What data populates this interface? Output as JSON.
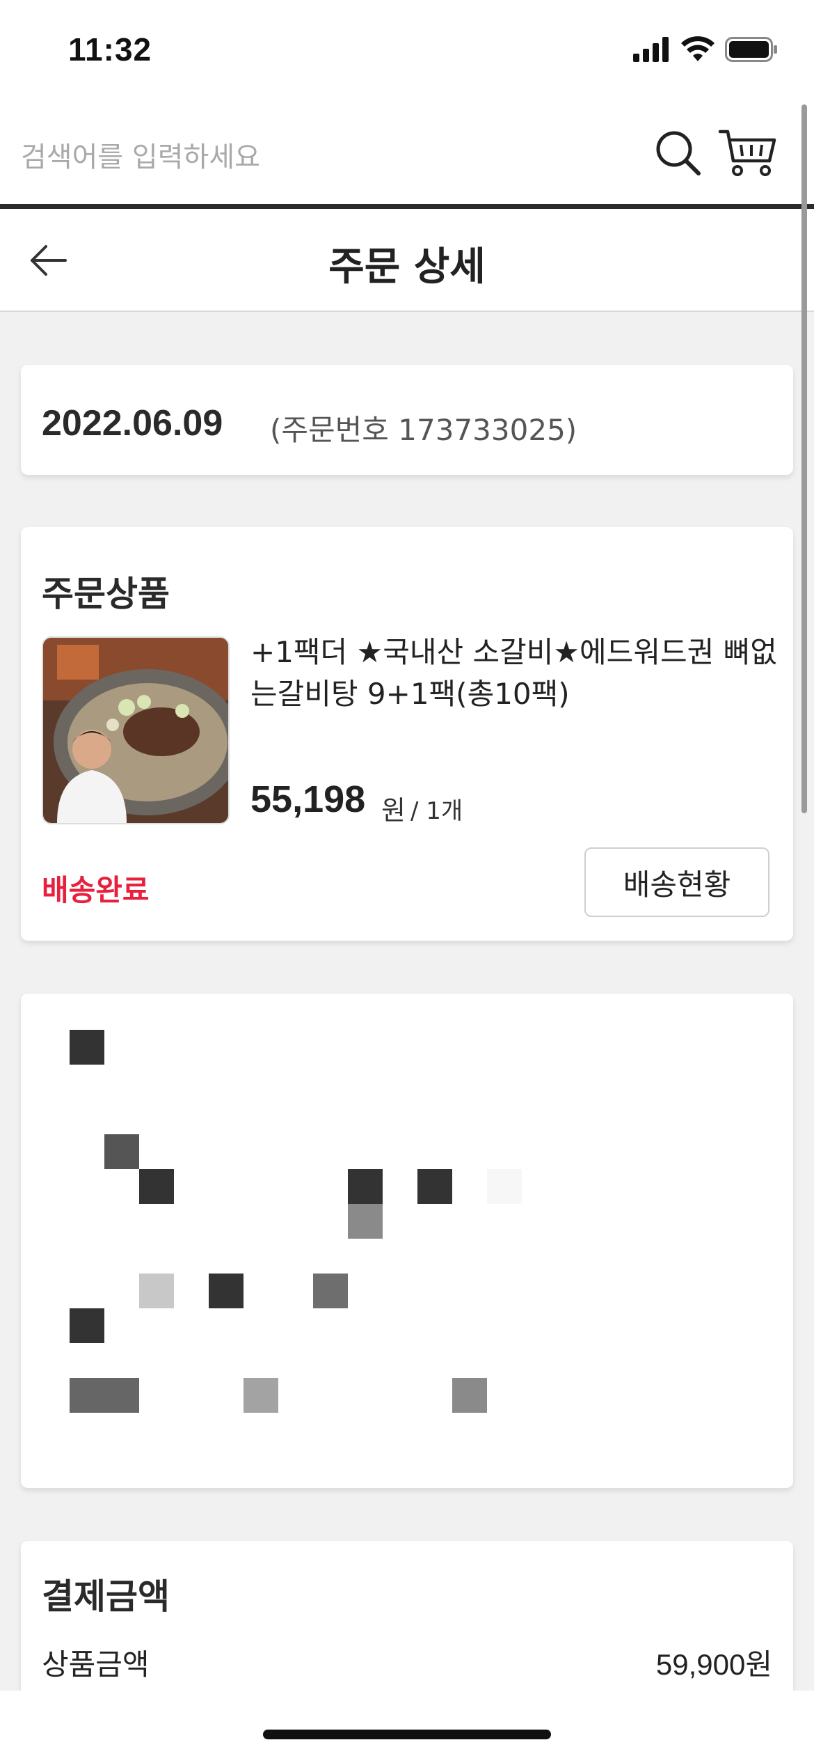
{
  "status_bar": {
    "time": "11:32"
  },
  "search": {
    "placeholder": "검색어를 입력하세요"
  },
  "header": {
    "title": "주문 상세"
  },
  "order": {
    "date": "2022.06.09",
    "order_number_text": "(주문번호 173733025)"
  },
  "ordered_items": {
    "section_title": "주문상품",
    "product": {
      "name": "+1팩더 ★국내산 소갈비★에드워드권 뼈없는갈비탕 9+1팩(총10팩)",
      "price": "55,198",
      "currency": "원",
      "quantity": "/ 1개",
      "status": "배송완료",
      "track_button": "배송현황"
    }
  },
  "payment": {
    "section_title": "결제금액",
    "rows": [
      {
        "label": "상품금액",
        "value": "59,900원"
      }
    ]
  },
  "colors": {
    "accent_red": "#e8203d",
    "divider_dark": "#2b2b2b",
    "background": "#f1f1f1"
  }
}
